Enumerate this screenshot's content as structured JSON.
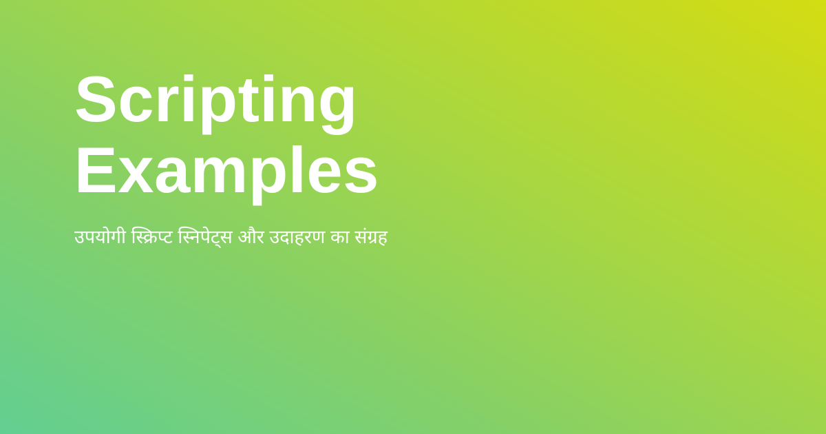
{
  "title_line_1": "Scripting",
  "title_line_2": "Examples",
  "subtitle": "उपयोगी स्क्रिप्ट स्निपेट्स और उदाहरण का संग्रह"
}
